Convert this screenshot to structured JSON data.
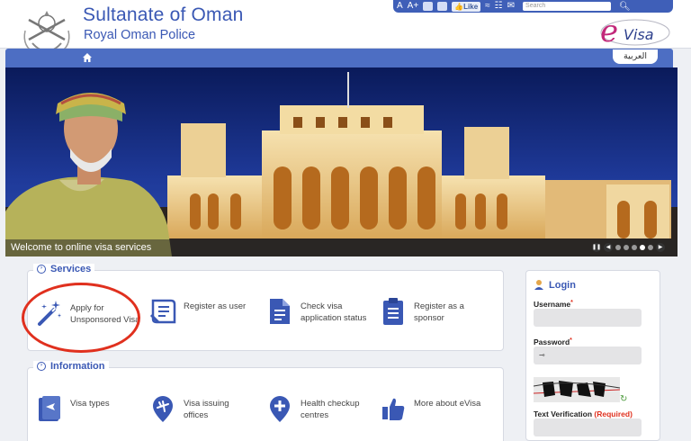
{
  "header": {
    "title": "Sultanate of Oman",
    "subtitle": "Royal Oman Police",
    "arabic_link": "العربية"
  },
  "toolbar": {
    "font_increase": "A+",
    "font_decrease": "A",
    "like_label": "Like",
    "search_placeholder": "Search"
  },
  "hero": {
    "caption": "Welcome to online visa services",
    "slide_count": 5,
    "active_slide": 4
  },
  "services": {
    "legend": "Services",
    "items": [
      {
        "label": "Apply for Unsponsored Visa",
        "icon": "magic-wand-icon"
      },
      {
        "label": "Register as user",
        "icon": "register-form-icon"
      },
      {
        "label": "Check visa application status",
        "icon": "document-icon"
      },
      {
        "label": "Register as a sponsor",
        "icon": "clipboard-icon"
      }
    ]
  },
  "information": {
    "legend": "Information",
    "items": [
      {
        "label": "Visa types",
        "icon": "passport-icon"
      },
      {
        "label": "Visa issuing offices",
        "icon": "airplane-pin-icon"
      },
      {
        "label": "Health checkup centres",
        "icon": "medical-cross-pin-icon"
      },
      {
        "label": "More about eVisa",
        "icon": "thumbs-up-icon"
      }
    ]
  },
  "login": {
    "title": "Login",
    "username_label": "Username",
    "password_label": "Password",
    "verification_label": "Text Verification",
    "required_text": "(Required)"
  },
  "colors": {
    "brand_blue": "#3a58b4",
    "nav_blue": "#4d6ec3",
    "highlight_red": "#e0301e"
  }
}
